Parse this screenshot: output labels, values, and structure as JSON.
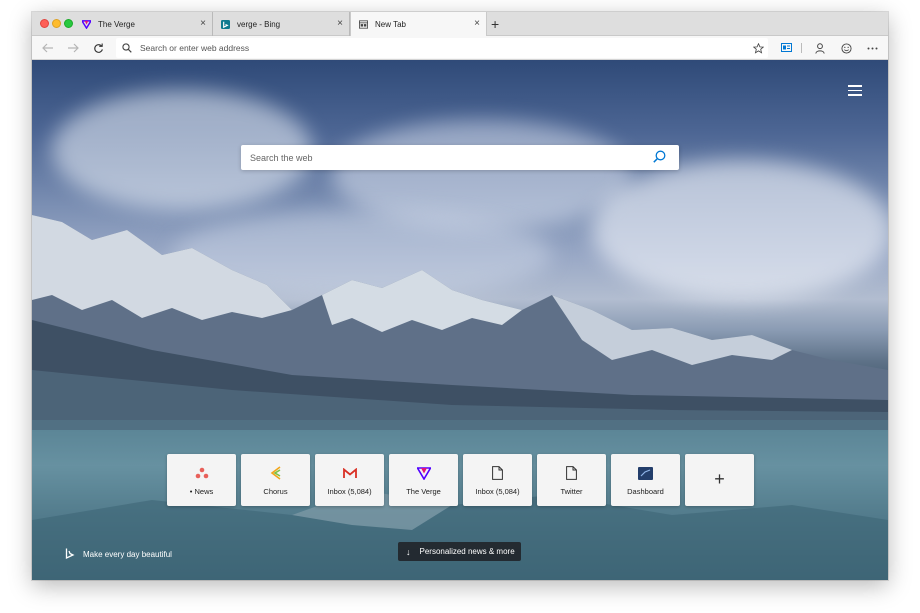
{
  "tabs": [
    {
      "title": "The Verge",
      "state": "inactive",
      "favicon": "verge-icon"
    },
    {
      "title": "verge - Bing",
      "state": "inactive",
      "favicon": "bing-icon"
    },
    {
      "title": "New Tab",
      "state": "active",
      "favicon": "newtab-icon"
    }
  ],
  "newtab_symbol": "+",
  "tab_close_symbol": "×",
  "toolbar": {
    "address_placeholder": "Search or enter web address",
    "icons": [
      "back-arrow-icon",
      "forward-arrow-icon",
      "refresh-icon",
      "star-icon",
      "reading-view-icon",
      "profile-icon",
      "emoji-icon",
      "more-icon"
    ]
  },
  "page": {
    "search_placeholder": "Search the web",
    "tiles": [
      {
        "label": "• News",
        "icon": "news-icon"
      },
      {
        "label": "Chorus",
        "icon": "chorus-icon"
      },
      {
        "label": "Inbox (5,084)",
        "icon": "gmail-icon"
      },
      {
        "label": "The Verge",
        "icon": "verge-icon"
      },
      {
        "label": "Inbox (5,084)",
        "icon": "document-icon"
      },
      {
        "label": "Twitter",
        "icon": "document-icon"
      },
      {
        "label": "Dashboard",
        "icon": "dashboard-icon"
      }
    ],
    "add_tile_symbol": "+",
    "brand_text": "Make every day beautiful",
    "news_button": "Personalized news & more",
    "news_arrow": "↓"
  },
  "colors": {
    "accent": "#0078d4",
    "gmail_red": "#d93025",
    "verge_purple": "#5200ff",
    "verge_pink": "#e2127a"
  }
}
